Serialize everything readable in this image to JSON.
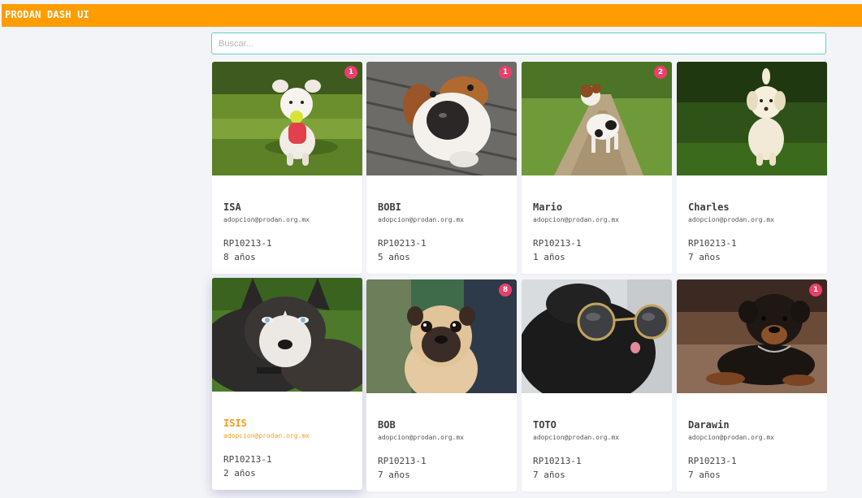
{
  "app": {
    "title": "PRODAN DASH UI"
  },
  "search": {
    "placeholder": "Buscar..."
  },
  "colors": {
    "accent": "#ff9d00",
    "badge": "#ec3f6c",
    "search_border": "#5ed3c0",
    "highlight": "#f59b1b"
  },
  "pets": [
    {
      "name": "ISA",
      "email": "adopcion@prodan.org.mx",
      "code": "RP10213-1",
      "age": "8 años",
      "badge": "1",
      "photo": "maltese-puppy-with-tennis-ball"
    },
    {
      "name": "BOBI",
      "email": "adopcion@prodan.org.mx",
      "code": "RP10213-1",
      "age": "5 años",
      "badge": "1",
      "photo": "beagle-nose-closeup"
    },
    {
      "name": "Mario",
      "email": "adopcion@prodan.org.mx",
      "code": "RP10213-1",
      "age": "1 años",
      "badge": "2",
      "photo": "jack-russell-on-trail"
    },
    {
      "name": "Charles",
      "email": "adopcion@prodan.org.mx",
      "code": "RP10213-1",
      "age": "7 años",
      "badge": "",
      "photo": "labrador-puppy-in-grass"
    },
    {
      "name": "ISIS",
      "email": "adopcion@prodan.org.mx",
      "code": "RP10213-1",
      "age": "2 años",
      "badge": "",
      "photo": "husky-portrait",
      "selected": true
    },
    {
      "name": "BOB",
      "email": "adopcion@prodan.org.mx",
      "code": "RP10213-1",
      "age": "7 años",
      "badge": "8",
      "photo": "pug-portrait"
    },
    {
      "name": "TOTO",
      "email": "adopcion@prodan.org.mx",
      "code": "RP10213-1",
      "age": "7 años",
      "badge": "",
      "photo": "pug-with-sunglasses"
    },
    {
      "name": "Darawin",
      "email": "adopcion@prodan.org.mx",
      "code": "RP10213-1",
      "age": "7 años",
      "badge": "1",
      "photo": "rottweiler-puppy-lying"
    }
  ]
}
